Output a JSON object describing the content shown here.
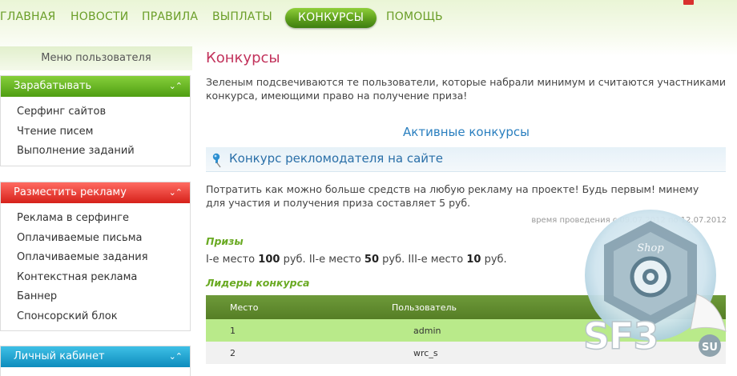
{
  "nav": {
    "items": [
      "ГЛАВНАЯ",
      "НОВОСТИ",
      "ПРАВИЛА",
      "ВЫПЛАТЫ",
      "КОНКУРСЫ",
      "ПОМОЩЬ"
    ],
    "active": "КОНКУРСЫ"
  },
  "sidebar": {
    "title": "Меню пользователя",
    "blocks": [
      {
        "title": "Зарабатывать",
        "color": "#5aa81a",
        "items": [
          "Серфинг сайтов",
          "Чтение писем",
          "Выполнение заданий"
        ]
      },
      {
        "title": "Разместить рекламу",
        "color": "#e0302a",
        "items": [
          "Реклама в серфинге",
          "Оплачиваемые письма",
          "Оплачиваемые задания",
          "Контекстная реклама",
          "Баннер",
          "Спонсорский блок"
        ]
      },
      {
        "title": "Личный кабинет",
        "color": "#1996c8",
        "items": []
      }
    ]
  },
  "main": {
    "title": "Конкурсы",
    "intro": "Зеленым подсвечиваются те пользователи, которые набрали минимум и считаются участниками конкурса, имеющими право на получение приза!",
    "active_heading": "Активные конкурсы",
    "contest": {
      "title": "Конкурс рекломодателя на сайте",
      "description": "Потратить как можно больше средств на любую рекламу на проекте! Будь первым! минему для участия и получения приза составляет 5 руб.",
      "period": "время проведения с 09.07.2012 по 12.07.2012",
      "prizes_heading": "Призы",
      "prizes": [
        {
          "place": "I-е место",
          "amount": "100",
          "unit": "руб."
        },
        {
          "place": "II-е место",
          "amount": "50",
          "unit": "руб."
        },
        {
          "place": "III-е место",
          "amount": "10",
          "unit": "руб."
        }
      ],
      "leaders_heading": "Лидеры конкурса",
      "table": {
        "columns": [
          "Место",
          "Пользователь",
          ""
        ],
        "rows": [
          {
            "place": "1",
            "user": "admin",
            "value": ""
          },
          {
            "place": "2",
            "user": "wrc_s",
            "value": ""
          }
        ]
      }
    }
  },
  "watermark": {
    "text": "SF3",
    "suffix": "SU",
    "badge": "Shop"
  },
  "colors": {
    "nav_text": "#6a9e28",
    "title_pink": "#c2325b",
    "link_blue": "#2a7fbf",
    "green_heading": "#6aaa23",
    "highlight_row": "#b9ea8a"
  }
}
